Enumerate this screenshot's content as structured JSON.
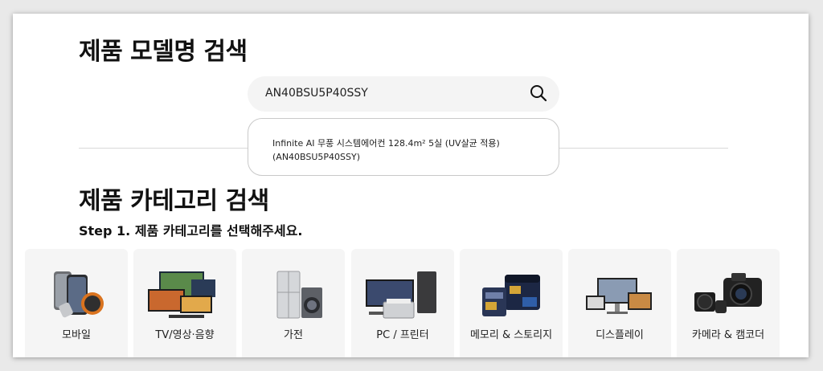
{
  "model_search": {
    "title": "제품 모델명 검색",
    "input_value": "AN40BSU5P40SSY",
    "suggestion_line1": "Infinite AI 무풍 시스템에어컨 128.4m² 5실 (UV살균 적용)",
    "suggestion_line2": "(AN40BSU5P40SSY)"
  },
  "category_search": {
    "title": "제품 카테고리 검색",
    "step": "Step 1. 제품 카테고리를 선택해주세요.",
    "categories": [
      {
        "label": "모바일",
        "icon": "mobile-icon"
      },
      {
        "label": "TV/영상·음향",
        "icon": "tv-icon"
      },
      {
        "label": "가전",
        "icon": "appliance-icon"
      },
      {
        "label": "PC / 프린터",
        "icon": "pc-printer-icon"
      },
      {
        "label": "메모리 & 스토리지",
        "icon": "memory-card-icon"
      },
      {
        "label": "디스플레이",
        "icon": "display-icon"
      },
      {
        "label": "카메라 & 캠코더",
        "icon": "camera-icon"
      }
    ]
  }
}
